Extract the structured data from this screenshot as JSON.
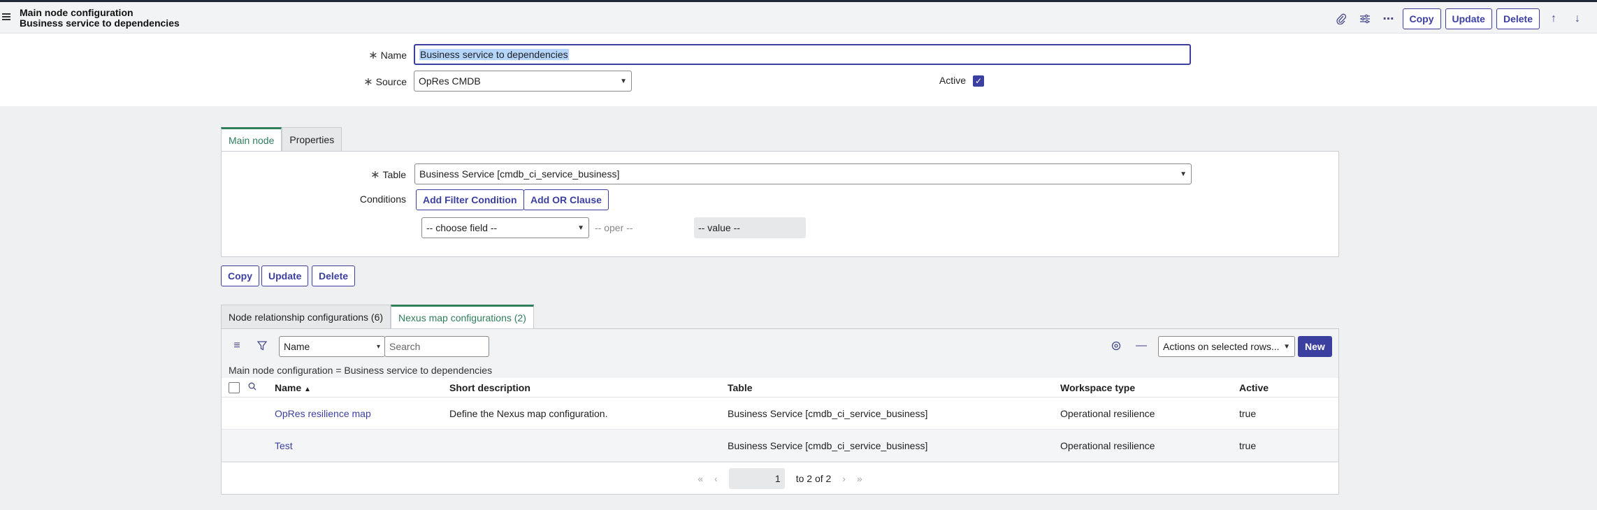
{
  "header": {
    "title_line1": "Main node configuration",
    "title_line2": "Business service to dependencies",
    "buttons": {
      "copy": "Copy",
      "update": "Update",
      "delete": "Delete"
    }
  },
  "form": {
    "name_label": "Name",
    "name_value": "Business service to dependencies",
    "source_label": "Source",
    "source_value": "OpRes CMDB",
    "active_label": "Active",
    "active_checked": true
  },
  "section_tabs": [
    {
      "label": "Main node",
      "active": true
    },
    {
      "label": "Properties",
      "active": false
    }
  ],
  "main_node": {
    "table_label": "Table",
    "table_value": "Business Service [cmdb_ci_service_business]",
    "conditions_label": "Conditions",
    "add_filter_label": "Add Filter Condition",
    "add_or_label": "Add OR Clause",
    "choose_field": "-- choose field --",
    "oper": "-- oper --",
    "value": "-- value --"
  },
  "form_buttons": {
    "copy": "Copy",
    "update": "Update",
    "delete": "Delete"
  },
  "related_tabs": [
    {
      "label": "Node relationship configurations (6)",
      "active": false
    },
    {
      "label": "Nexus map configurations (2)",
      "active": true
    }
  ],
  "list": {
    "search_field": "Name",
    "search_placeholder": "Search",
    "actions_label": "Actions on selected rows...",
    "new_label": "New",
    "breadcrumb": "Main node configuration = Business service to dependencies",
    "columns": [
      "Name",
      "Short description",
      "Table",
      "Workspace type",
      "Active"
    ],
    "rows": [
      {
        "name": "OpRes resilience map",
        "short_description": "Define the Nexus map configuration.",
        "table": "Business Service [cmdb_ci_service_business]",
        "workspace_type": "Operational resilience",
        "active": "true"
      },
      {
        "name": "Test",
        "short_description": "",
        "table": "Business Service [cmdb_ci_service_business]",
        "workspace_type": "Operational resilience",
        "active": "true"
      }
    ],
    "pager": {
      "page_value": "1",
      "range_text": "to 2 of 2"
    }
  },
  "icons": [
    "menu-icon",
    "attachment-icon",
    "settings-sliders-icon",
    "more-icon",
    "arrow-up-icon",
    "arrow-down-icon",
    "filter-icon",
    "search-icon",
    "gear-icon",
    "collapse-icon",
    "sort-asc-icon"
  ]
}
